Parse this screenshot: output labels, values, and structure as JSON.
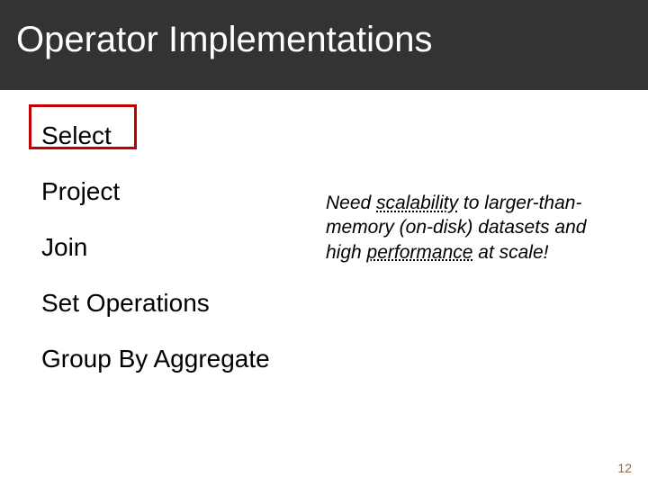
{
  "header": {
    "title": "Operator Implementations"
  },
  "operators": {
    "items": [
      {
        "label": "Select"
      },
      {
        "label": "Project"
      },
      {
        "label": "Join"
      },
      {
        "label": "Set Operations"
      },
      {
        "label": "Group By Aggregate"
      }
    ]
  },
  "callout": {
    "pre": "Need ",
    "u1": "scalability",
    "mid": " to larger-than-memory (on-disk) datasets and high ",
    "u2": "performance",
    "post": " at scale!"
  },
  "page": {
    "number": "12"
  }
}
